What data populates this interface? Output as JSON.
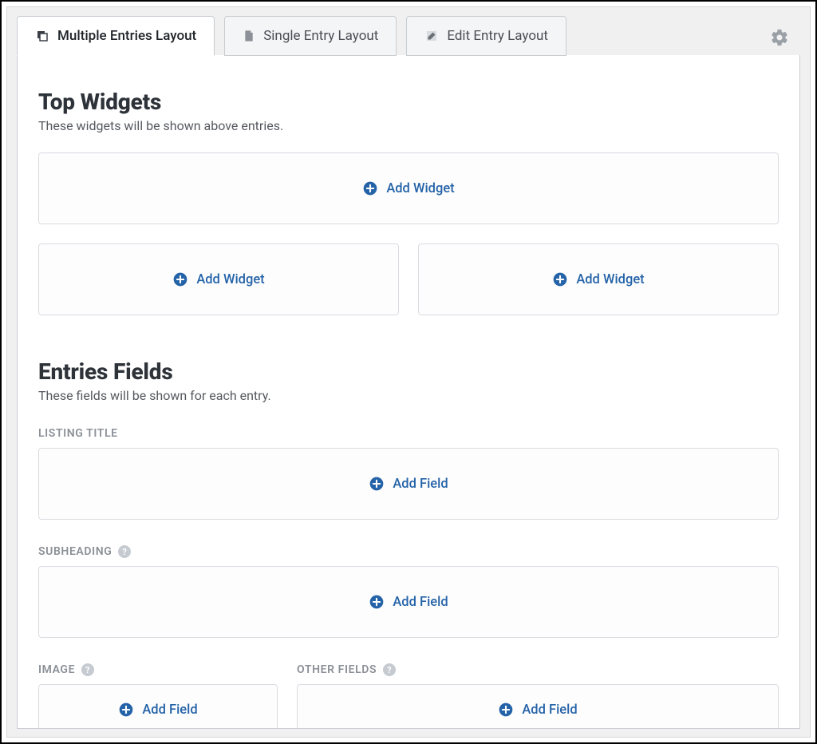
{
  "tabs": {
    "multiple": "Multiple Entries Layout",
    "single": "Single Entry Layout",
    "edit": "Edit Entry Layout"
  },
  "section_top": {
    "title": "Top Widgets",
    "desc": "These widgets will be shown above entries.",
    "add_label": "Add Widget"
  },
  "section_entries": {
    "title": "Entries Fields",
    "desc": "These fields will be shown for each entry.",
    "listing_title_label": "LISTING TITLE",
    "subheading_label": "SUBHEADING",
    "image_label": "IMAGE",
    "other_fields_label": "OTHER FIELDS",
    "add_field_label": "Add Field"
  },
  "colors": {
    "link": "#2563a8"
  }
}
